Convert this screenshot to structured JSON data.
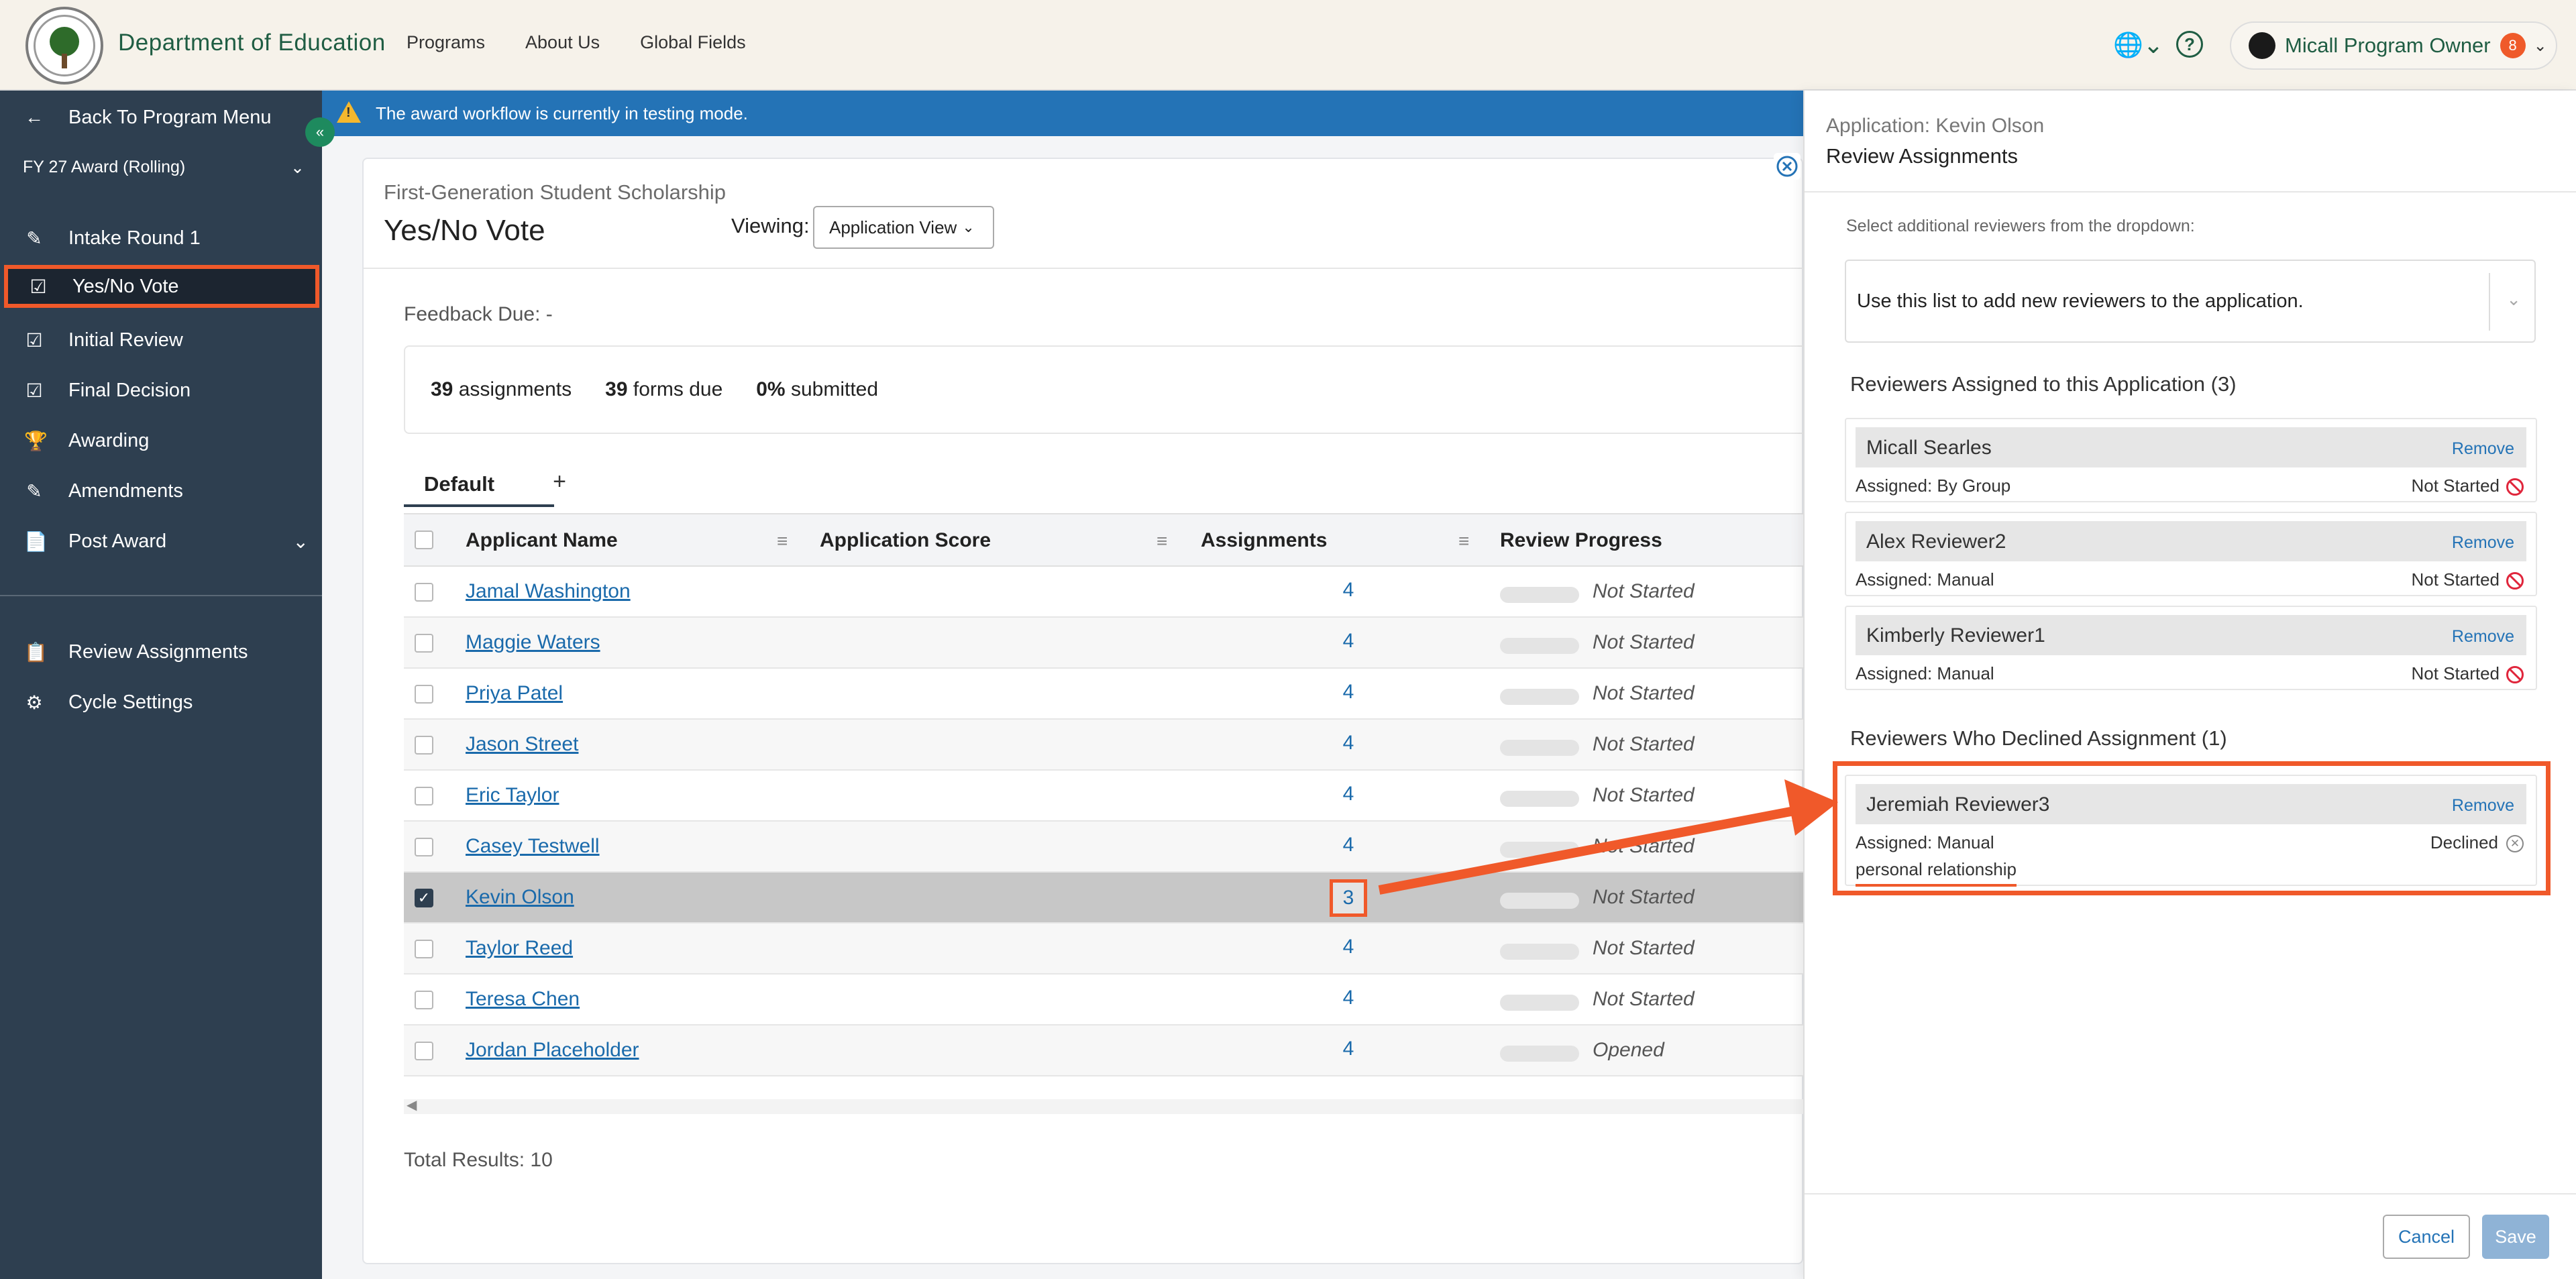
{
  "header": {
    "org_name": "Department of Education",
    "nav": [
      "Programs",
      "About Us",
      "Global Fields"
    ],
    "user_name": "Micall Program Owner",
    "notification_count": "8"
  },
  "sidebar": {
    "back_label": "Back To Program Menu",
    "cycle_select": "FY 27 Award (Rolling)",
    "items": [
      {
        "label": "Intake Round 1",
        "icon": "form-edit-icon"
      },
      {
        "label": "Yes/No Vote",
        "icon": "form-check-icon",
        "active": true
      },
      {
        "label": "Initial Review",
        "icon": "form-check-icon"
      },
      {
        "label": "Final Decision",
        "icon": "form-check-icon"
      },
      {
        "label": "Awarding",
        "icon": "trophy-icon"
      },
      {
        "label": "Amendments",
        "icon": "form-edit-icon"
      },
      {
        "label": "Post Award",
        "icon": "document-dollar-icon"
      }
    ],
    "bottom_items": [
      {
        "label": "Review Assignments",
        "icon": "clipboard-icon"
      },
      {
        "label": "Cycle Settings",
        "icon": "gear-icon"
      }
    ]
  },
  "banner": {
    "text": "The award workflow is currently in testing mode."
  },
  "main": {
    "subtitle": "First-Generation Student Scholarship",
    "title": "Yes/No Vote",
    "viewing_label": "Viewing:",
    "view_select": "Application View",
    "feedback_due": "Feedback Due: -",
    "stats": [
      {
        "value": "39",
        "label": "assignments"
      },
      {
        "value": "39",
        "label": "forms due"
      },
      {
        "value": "0%",
        "label": "submitted"
      }
    ],
    "tab_default": "Default",
    "tab_add": "+",
    "columns": [
      "Applicant Name",
      "Application Score",
      "Assignments",
      "Review Progress"
    ],
    "rows": [
      {
        "name": "Jamal Washington",
        "assignments": "4",
        "progress": "Not Started"
      },
      {
        "name": "Maggie Waters",
        "assignments": "4",
        "progress": "Not Started"
      },
      {
        "name": "Priya Patel",
        "assignments": "4",
        "progress": "Not Started"
      },
      {
        "name": "Jason Street",
        "assignments": "4",
        "progress": "Not Started"
      },
      {
        "name": "Eric Taylor",
        "assignments": "4",
        "progress": "Not Started"
      },
      {
        "name": "Casey Testwell",
        "assignments": "4",
        "progress": "Not Started"
      },
      {
        "name": "Kevin Olson",
        "assignments": "3",
        "progress": "Not Started",
        "selected": true
      },
      {
        "name": "Taylor Reed",
        "assignments": "4",
        "progress": "Not Started"
      },
      {
        "name": "Teresa Chen",
        "assignments": "4",
        "progress": "Not Started"
      },
      {
        "name": "Jordan Placeholder",
        "assignments": "4",
        "progress": "Opened"
      }
    ],
    "total_results": "Total Results: 10"
  },
  "panel": {
    "application": "Application: Kevin Olson",
    "title": "Review Assignments",
    "hint": "Select additional reviewers from the dropdown:",
    "select_placeholder": "Use this list to add new reviewers to the application.",
    "assigned_heading": "Reviewers Assigned to this Application (3)",
    "assigned": [
      {
        "name": "Micall Searles",
        "remove": "Remove",
        "assigned": "Assigned: By Group",
        "status": "Not Started"
      },
      {
        "name": "Alex Reviewer2",
        "remove": "Remove",
        "assigned": "Assigned: Manual",
        "status": "Not Started"
      },
      {
        "name": "Kimberly Reviewer1",
        "remove": "Remove",
        "assigned": "Assigned: Manual",
        "status": "Not Started"
      }
    ],
    "declined_heading": "Reviewers Who Declined Assignment (1)",
    "declined": [
      {
        "name": "Jeremiah Reviewer3",
        "remove": "Remove",
        "assigned": "Assigned: Manual",
        "status": "Declined",
        "reason": "personal relationship"
      }
    ],
    "cancel": "Cancel",
    "save": "Save"
  },
  "colors": {
    "accent": "#f0592a",
    "sidebar_bg": "#2e3f50",
    "link": "#1a6aab",
    "banner": "#2473b6",
    "brand_green": "#1f5d43"
  }
}
